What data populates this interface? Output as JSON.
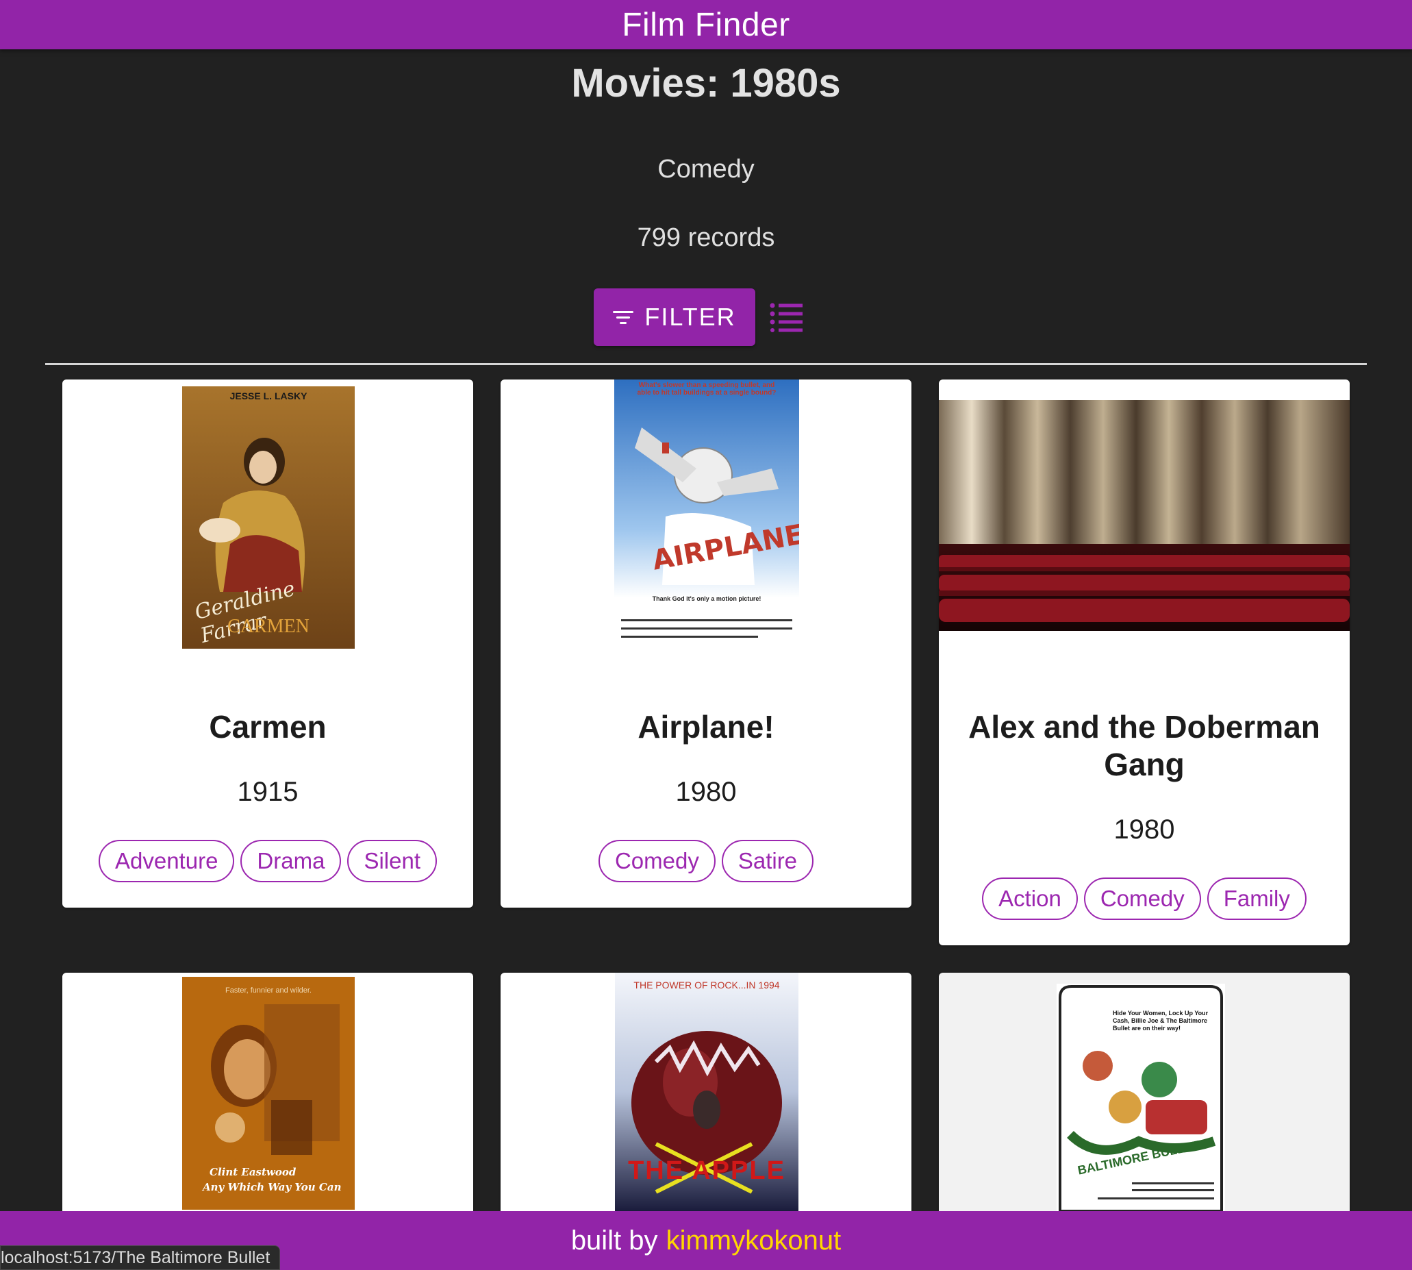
{
  "header": {
    "title": "Film Finder"
  },
  "page": {
    "title": "Movies: 1980s",
    "genre": "Comedy",
    "record_count": "799 records"
  },
  "toolbar": {
    "filter_label": "FILTER",
    "filter_icon": "filter-icon",
    "view_icon": "list-view-icon"
  },
  "movies": [
    {
      "title": "Carmen",
      "year": "1915",
      "genres": [
        "Adventure",
        "Drama",
        "Silent"
      ],
      "poster": {
        "text_top": "JESSE L. LASKY",
        "text_script": "Geraldine Farrar",
        "text_title": "CARMEN"
      }
    },
    {
      "title": "Airplane!",
      "year": "1980",
      "genres": [
        "Comedy",
        "Satire"
      ],
      "poster": {
        "text_top": "What's slower than a speeding bullet, and able to hit tall buildings at a single bound?",
        "text_title": "AIRPLANE!",
        "text_tagline": "Thank God it's only a motion picture!"
      }
    },
    {
      "title": "Alex and the Doberman Gang",
      "year": "1980",
      "genres": [
        "Action",
        "Comedy",
        "Family"
      ],
      "poster": {
        "placeholder": "theater-curtain-image"
      }
    },
    {
      "poster": {
        "text_top": "Faster, funnier and wilder.",
        "text_bottom1": "Clint Eastwood",
        "text_bottom2": "Any Which Way You Can"
      }
    },
    {
      "poster": {
        "text_top": "THE POWER OF ROCK...IN 1994",
        "text_title": "THE APPLE"
      }
    },
    {
      "poster": {
        "text_top": "Hide Your Women, Lock Up Your Cash, Billie Joe & The Baltimore Bullet are on their way!",
        "text_title": "BALTIMORE BULLET"
      }
    }
  ],
  "footer": {
    "built_by": "built by",
    "author": "kimmykokonut"
  },
  "status_bar": {
    "url": "localhost:5173/The Baltimore Bullet"
  },
  "colors": {
    "brand": "#9224a8",
    "chip": "#9c27b0",
    "author_link": "#ffd600",
    "background": "#212121"
  }
}
